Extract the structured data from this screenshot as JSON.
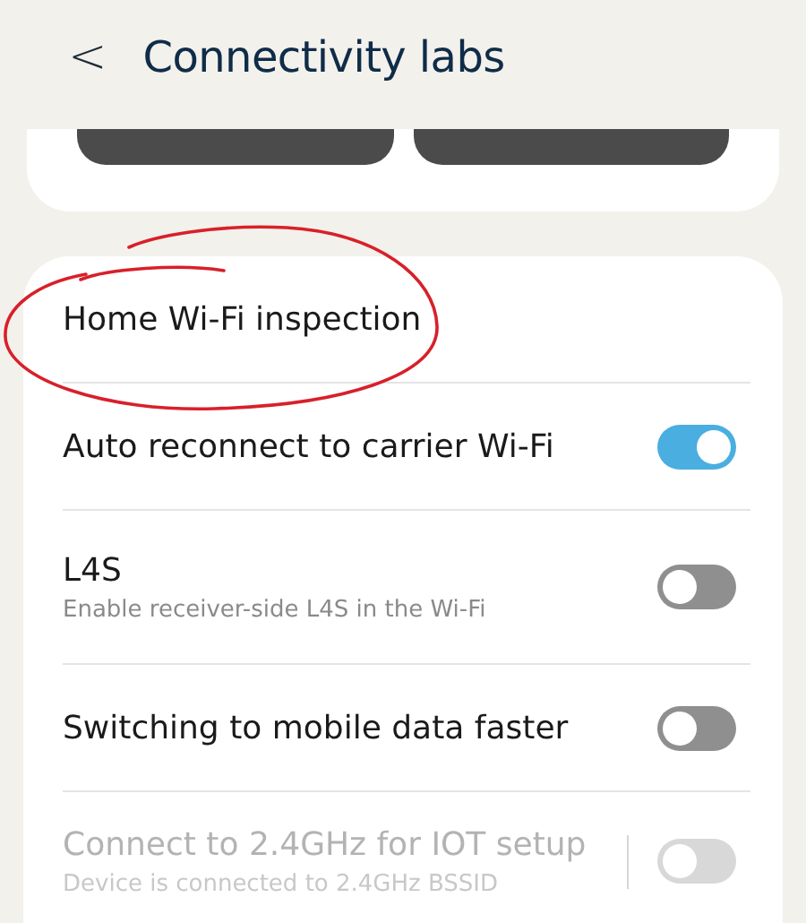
{
  "header": {
    "back": "<",
    "title": "Connectivity labs"
  },
  "settings": [
    {
      "kind": "link",
      "title": "Home Wi-Fi inspection",
      "annotated": true
    },
    {
      "kind": "toggle",
      "title": "Auto reconnect to carrier Wi-Fi",
      "on": true,
      "disabled": false
    },
    {
      "kind": "toggle",
      "title": "L4S",
      "subtitle": "Enable receiver-side L4S in the Wi-Fi",
      "on": false,
      "disabled": false
    },
    {
      "kind": "toggle",
      "title": "Switching to mobile data faster",
      "on": false,
      "disabled": false
    },
    {
      "kind": "toggle",
      "title": "Connect to 2.4GHz for IOT setup",
      "subtitle": "Device is connected to 2.4GHz BSSID",
      "on": false,
      "disabled": true,
      "has_detail": true
    }
  ]
}
